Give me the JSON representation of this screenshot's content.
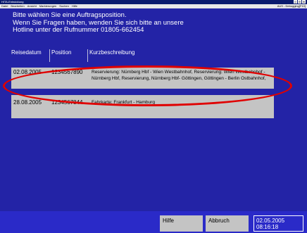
{
  "window": {
    "title": "HITA-Entwicklung"
  },
  "menu": {
    "items": [
      "Datei",
      "Bearbeiten",
      "Ansicht",
      "Markierungen",
      "Suchen",
      "Hilfe"
    ],
    "mode_label": "AUS - Debugging[F10]"
  },
  "intro": {
    "line1": "Bitte wählen Sie eine Auftragsposition.",
    "line2": "Wenn Sie Fragen haben, wenden Sie sich bitte an unsere",
    "line3": "Hotline unter der Rufnummer 01805-662454"
  },
  "table": {
    "headers": {
      "date": "Reisedatum",
      "position": "Position",
      "description": "Kurzbeschreibung"
    },
    "rows": [
      {
        "date": "02.08.2005",
        "position": "1234567890",
        "desc_line1": "Reservierung: Nürnberg Hbf - Wien Westbahnhof, Reservierung: Wien Westbahnhof -",
        "desc_line2": "Nürnberg Hbf, Reservierung, Nürnberg Hbf- Göttingen, Göttingen - Berlin Ostbahnhof,"
      },
      {
        "date": "28.08.2005",
        "position": "1234567844",
        "desc_line1": "Fahrkarte: Frankfurt - Hamburg"
      }
    ]
  },
  "footer": {
    "help_label": "Hilfe",
    "cancel_label": "Abbruch",
    "date": "02.05.2005",
    "time": "08:16:18"
  }
}
